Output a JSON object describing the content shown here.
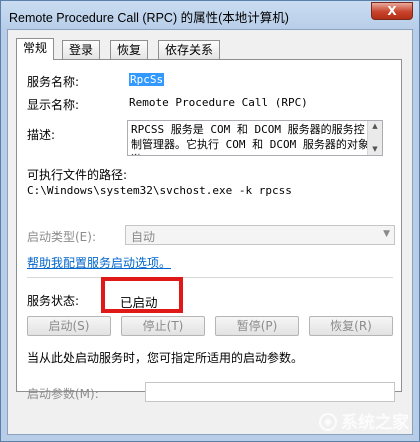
{
  "window": {
    "title": "Remote Procedure Call (RPC) 的属性(本地计算机)",
    "close_glyph": "X"
  },
  "tabs": [
    {
      "label": "常规",
      "active": true
    },
    {
      "label": "登录",
      "active": false
    },
    {
      "label": "恢复",
      "active": false
    },
    {
      "label": "依存关系",
      "active": false
    }
  ],
  "general": {
    "service_name_label": "服务名称:",
    "service_name_value": "RpcSs",
    "display_name_label": "显示名称:",
    "display_name_value": "Remote Procedure Call (RPC)",
    "description_label": "描述:",
    "description_value": "RPCSS 服务是 COM 和 DCOM 服务器的服务控制管理器。它执行 COM 和 DCOM 服务器的对象激",
    "exe_path_label": "可执行文件的路径:",
    "exe_path_value": "C:\\Windows\\system32\\svchost.exe -k rpcss",
    "startup_type_label": "启动类型(E):",
    "startup_type_value": "自动",
    "help_link": "帮助我配置服务启动选项。",
    "status_label": "服务状态:",
    "status_value": "已启动",
    "buttons": {
      "start": "启动(S)",
      "stop": "停止(T)",
      "pause": "暂停(P)",
      "resume": "恢复(R)"
    },
    "hint": "当从此处启动服务时，您可指定所适用的启动参数。",
    "params_label": "启动参数(M):",
    "params_value": ""
  },
  "watermark": "系统之家",
  "colors": {
    "highlight_box": "#e01818",
    "link": "#0066cc",
    "selection": "#3399ff"
  }
}
